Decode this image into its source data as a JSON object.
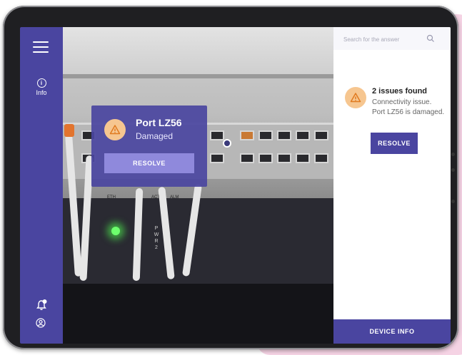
{
  "sidebar": {
    "menu_icon": "hamburger-icon",
    "info_label": "Info",
    "info_icon": "info-icon",
    "bell_icon": "bell-icon",
    "user_icon": "user-icon"
  },
  "camera": {
    "port_labels": [
      "ETH",
      "ACT",
      "ALM"
    ],
    "pwr_label": [
      "P",
      "W",
      "R",
      "2"
    ]
  },
  "port_card": {
    "title": "Port LZ56",
    "status": "Damaged",
    "resolve_label": "RESOLVE",
    "icon": "warning-icon"
  },
  "panel": {
    "search_placeholder": "Search for the answer",
    "issues_title": "2 issues found",
    "issue_line_1": "Connectivity issue.",
    "issue_line_2": "Port LZ56 is damaged.",
    "resolve_label": "RESOLVE",
    "device_info_label": "DEVICE INFO"
  },
  "colors": {
    "brand": "#4a45a0",
    "warning": "#f6c690",
    "warning_stroke": "#e07a1f"
  }
}
